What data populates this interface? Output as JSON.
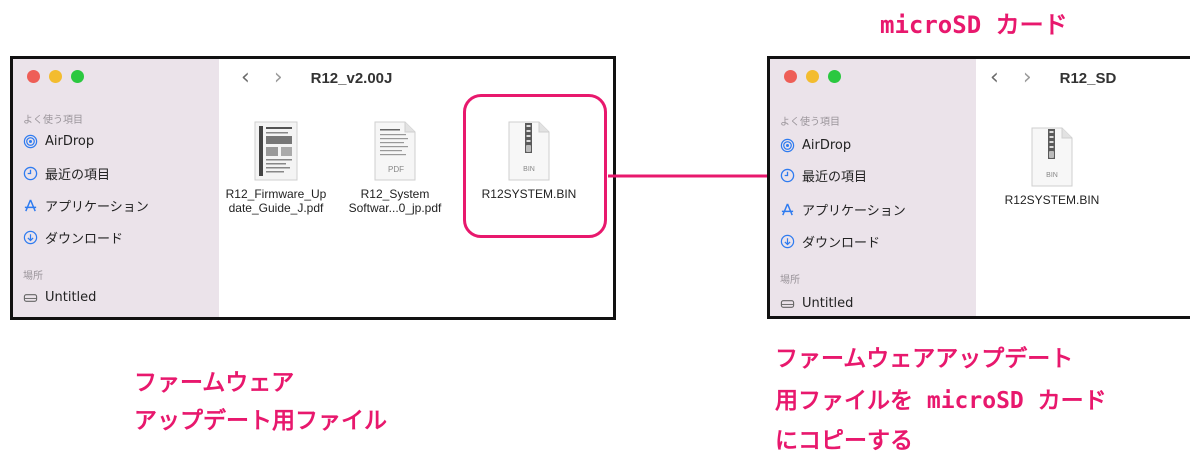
{
  "colors": {
    "accent": "#e8186d",
    "sidebar_bg": "#ebe3ea"
  },
  "left_window": {
    "title": "R12_v2.00J",
    "sidebar": {
      "favorites_label": "よく使う項目",
      "items": [
        {
          "label": "AirDrop",
          "icon": "airdrop-icon"
        },
        {
          "label": "最近の項目",
          "icon": "clock-icon"
        },
        {
          "label": "アプリケーション",
          "icon": "applications-icon"
        },
        {
          "label": "ダウンロード",
          "icon": "download-icon"
        }
      ],
      "locations_label": "場所",
      "location_items": [
        {
          "label": "Untitled",
          "icon": "drive-icon"
        }
      ]
    },
    "files": [
      {
        "name": "R12_Firmware_Up\ndate_Guide_J.pdf",
        "icon": "pdf-document-icon"
      },
      {
        "name": "R12_System\nSoftwar...0_jp.pdf",
        "icon": "pdf-file-icon",
        "badge": "PDF"
      },
      {
        "name": "R12SYSTEM.BIN",
        "icon": "bin-file-icon",
        "badge": "BIN"
      }
    ]
  },
  "right_window": {
    "title": "R12_SD",
    "sidebar": {
      "favorites_label": "よく使う項目",
      "items": [
        {
          "label": "AirDrop",
          "icon": "airdrop-icon"
        },
        {
          "label": "最近の項目",
          "icon": "clock-icon"
        },
        {
          "label": "アプリケーション",
          "icon": "applications-icon"
        },
        {
          "label": "ダウンロード",
          "icon": "download-icon"
        }
      ],
      "locations_label": "場所",
      "location_items": [
        {
          "label": "Untitled",
          "icon": "drive-icon"
        }
      ]
    },
    "files": [
      {
        "name": "R12SYSTEM.BIN",
        "icon": "bin-file-icon",
        "badge": "BIN"
      }
    ]
  },
  "annotations": {
    "microsd_label": "microSD カード",
    "left_caption_line1": "ファームウェア",
    "left_caption_line2": "アップデート用ファイル",
    "right_caption_line1": "ファームウェアアップデート",
    "right_caption_line2": "用ファイルを microSD カード",
    "right_caption_line3": "にコピーする"
  }
}
